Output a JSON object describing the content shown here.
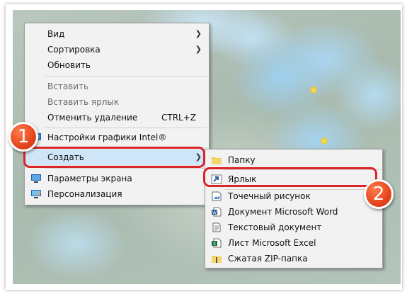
{
  "context_menu": {
    "items": [
      {
        "label": "Вид"
      },
      {
        "label": "Сортировка"
      },
      {
        "label": "Обновить"
      },
      {
        "label": "Вставить"
      },
      {
        "label": "Вставить ярлык"
      },
      {
        "label": "Отменить удаление",
        "shortcut": "CTRL+Z"
      },
      {
        "label": "Настройки графики Intel®"
      },
      {
        "label": "Создать"
      },
      {
        "label": "Параметры экрана"
      },
      {
        "label": "Персонализация"
      }
    ]
  },
  "create_submenu": {
    "items": [
      {
        "label": "Папку"
      },
      {
        "label": "Ярлык"
      },
      {
        "label": "Точечный рисунок"
      },
      {
        "label": "Документ Microsoft Word"
      },
      {
        "label": "Текстовый документ"
      },
      {
        "label": "Лист Microsoft Excel"
      },
      {
        "label": "Сжатая ZIP-папка"
      }
    ]
  },
  "annotations": {
    "step1": "1",
    "step2": "2",
    "color": "#d9262a"
  },
  "icons": [
    "intel-graphics-icon",
    "folder-icon",
    "shortcut-icon",
    "bitmap-icon",
    "word-document-icon",
    "text-document-icon",
    "excel-icon",
    "zip-folder-icon",
    "display-settings-icon",
    "personalization-icon"
  ]
}
